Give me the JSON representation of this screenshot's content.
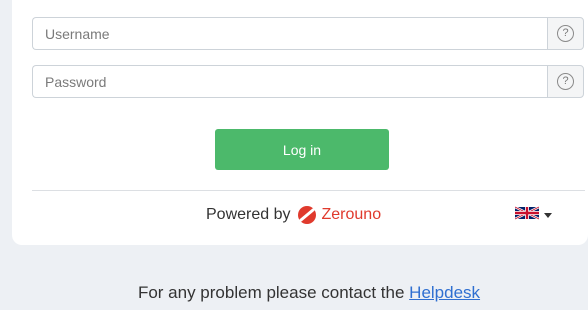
{
  "login": {
    "username_placeholder": "Username",
    "username_value": "",
    "password_placeholder": "Password",
    "password_value": "",
    "help_symbol": "?",
    "login_button": "Log in"
  },
  "branding": {
    "powered_by": "Powered by",
    "brand_name": "Zerouno",
    "brand_color": "#e03a2d"
  },
  "language": {
    "selected": "English",
    "flag_icon": "uk-flag-icon"
  },
  "footer": {
    "text": "For any problem please contact the",
    "link_label": "Helpdesk"
  },
  "colors": {
    "accent": "#4cb96b",
    "background": "#edf0f4",
    "link": "#2f6fd1"
  }
}
